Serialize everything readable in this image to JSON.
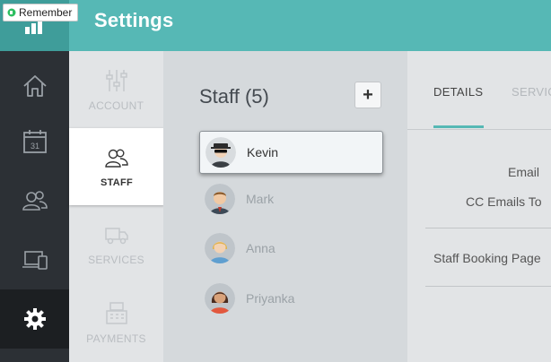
{
  "header": {
    "title": "Settings",
    "remember_label": "Remember"
  },
  "left_nav": {
    "items": [
      {
        "icon": "home-icon"
      },
      {
        "icon": "calendar-icon",
        "day": "31"
      },
      {
        "icon": "customers-icon"
      },
      {
        "icon": "devices-icon"
      },
      {
        "icon": "gear-icon",
        "active": true
      }
    ]
  },
  "settings_menu": {
    "items": [
      {
        "label": "ACCOUNT",
        "icon": "sliders-icon"
      },
      {
        "label": "STAFF",
        "icon": "staff-icon",
        "active": true
      },
      {
        "label": "SERVICES",
        "icon": "truck-icon"
      },
      {
        "label": "PAYMENTS",
        "icon": "register-icon"
      }
    ]
  },
  "staff": {
    "title": "Staff (5)",
    "add_label": "+",
    "members": [
      {
        "name": "Kevin",
        "active": true
      },
      {
        "name": "Mark"
      },
      {
        "name": "Anna"
      },
      {
        "name": "Priyanka"
      }
    ]
  },
  "details": {
    "tabs": [
      {
        "label": "DETAILS",
        "active": true
      },
      {
        "label": "SERVIC"
      }
    ],
    "fields": {
      "email_label": "Email",
      "cc_label": "CC Emails To",
      "booking_label": "Staff Booking Page"
    }
  },
  "colors": {
    "accent": "#56b8b5",
    "nav_bg": "#2c3035"
  }
}
